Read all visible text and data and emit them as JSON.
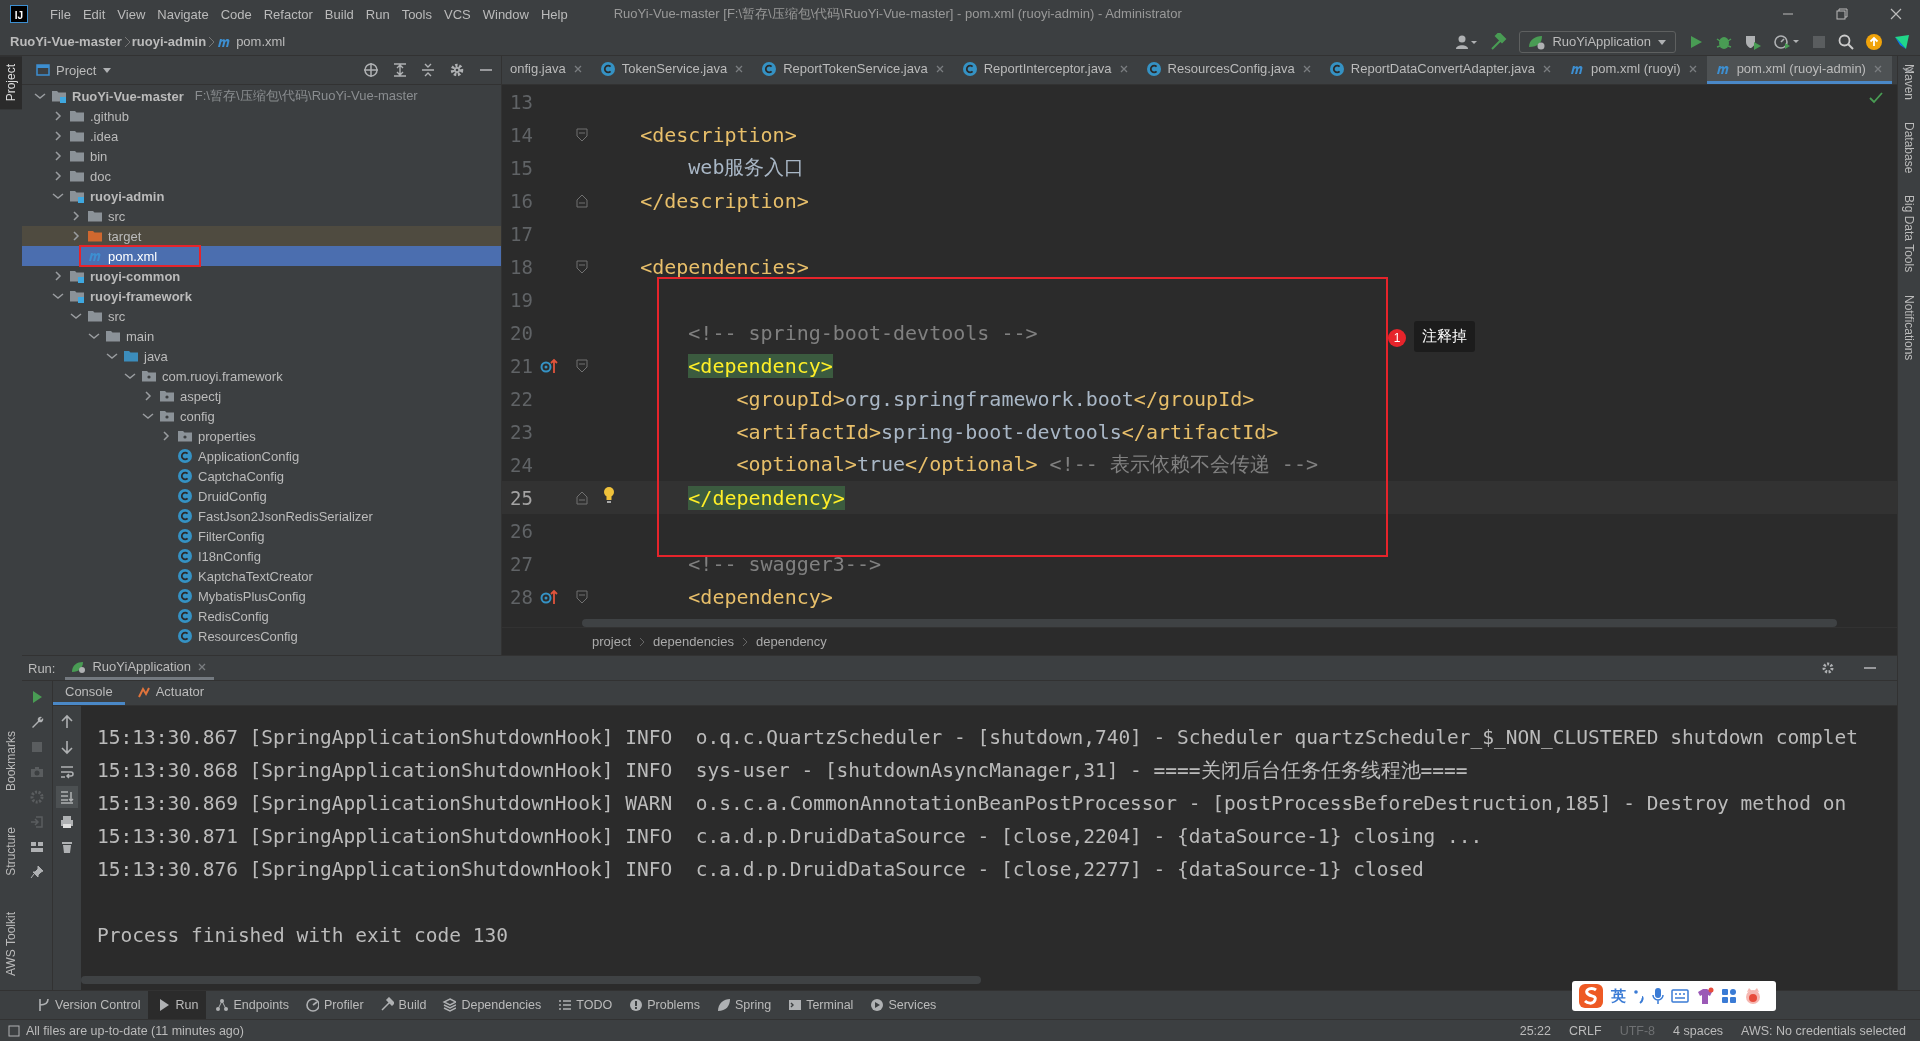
{
  "window": {
    "logo": "IJ",
    "title": "RuoYi-Vue-master [F:\\暂存\\压缩包\\代码\\RuoYi-Vue-master] - pom.xml (ruoyi-admin) - Administrator"
  },
  "menu": [
    "File",
    "Edit",
    "View",
    "Navigate",
    "Code",
    "Refactor",
    "Build",
    "Run",
    "Tools",
    "VCS",
    "Window",
    "Help"
  ],
  "nav_path": [
    {
      "label": "RuoYi-Vue-master",
      "kind": "project"
    },
    {
      "label": "ruoyi-admin",
      "kind": "module"
    },
    {
      "label": "pom.xml",
      "kind": "maven"
    }
  ],
  "run_config": "RuoYiApplication",
  "left_stripe": [
    {
      "label": "Project",
      "selected": true
    },
    {
      "label": "Bookmarks",
      "selected": false
    },
    {
      "label": "Structure",
      "selected": false
    },
    {
      "label": "AWS Toolkit",
      "selected": false
    }
  ],
  "right_stripe": [
    "Maven",
    "Database",
    "Big Data Tools",
    "Notifications"
  ],
  "project": {
    "title": "Project",
    "tree": [
      {
        "label": "RuoYi-Vue-master",
        "path": "F:\\暂存\\压缩包\\代码\\RuoYi-Vue-master",
        "kind": "module",
        "expanded": true,
        "selected": false,
        "marked": false,
        "children": [
          {
            "label": ".github",
            "kind": "folder",
            "expanded": false,
            "selected": false,
            "marked": false
          },
          {
            "label": ".idea",
            "kind": "folder",
            "expanded": false,
            "selected": false,
            "marked": false
          },
          {
            "label": "bin",
            "kind": "folder",
            "expanded": false,
            "selected": false,
            "marked": false
          },
          {
            "label": "doc",
            "kind": "folder",
            "expanded": false,
            "selected": false,
            "marked": false
          },
          {
            "label": "ruoyi-admin",
            "kind": "module",
            "expanded": true,
            "selected": false,
            "marked": false,
            "children": [
              {
                "label": "src",
                "kind": "folder",
                "expanded": false,
                "selected": false,
                "marked": false
              },
              {
                "label": "target",
                "kind": "excluded",
                "expanded": false,
                "selected": false,
                "marked": false
              },
              {
                "label": "pom.xml",
                "kind": "maven",
                "selected": true,
                "marked": true
              }
            ]
          },
          {
            "label": "ruoyi-common",
            "kind": "module",
            "expanded": false,
            "selected": false,
            "marked": false
          },
          {
            "label": "ruoyi-framework",
            "kind": "module",
            "expanded": true,
            "selected": false,
            "marked": false,
            "children": [
              {
                "label": "src",
                "kind": "folder",
                "expanded": true,
                "selected": false,
                "marked": false,
                "children": [
                  {
                    "label": "main",
                    "kind": "folder",
                    "expanded": true,
                    "selected": false,
                    "marked": false,
                    "children": [
                      {
                        "label": "java",
                        "kind": "source",
                        "expanded": true,
                        "selected": false,
                        "marked": false,
                        "children": [
                          {
                            "label": "com.ruoyi.framework",
                            "kind": "package",
                            "expanded": true,
                            "selected": false,
                            "marked": false,
                            "children": [
                              {
                                "label": "aspectj",
                                "kind": "package",
                                "expanded": false,
                                "selected": false,
                                "marked": false
                              },
                              {
                                "label": "config",
                                "kind": "package",
                                "expanded": true,
                                "selected": false,
                                "marked": false,
                                "children": [
                                  {
                                    "label": "properties",
                                    "kind": "package",
                                    "expanded": false,
                                    "selected": false,
                                    "marked": false
                                  },
                                  {
                                    "label": "ApplicationConfig",
                                    "kind": "class",
                                    "selected": false,
                                    "marked": false
                                  },
                                  {
                                    "label": "CaptchaConfig",
                                    "kind": "class",
                                    "selected": false,
                                    "marked": false
                                  },
                                  {
                                    "label": "DruidConfig",
                                    "kind": "class",
                                    "selected": false,
                                    "marked": false
                                  },
                                  {
                                    "label": "FastJson2JsonRedisSerializer",
                                    "kind": "class",
                                    "selected": false,
                                    "marked": false
                                  },
                                  {
                                    "label": "FilterConfig",
                                    "kind": "class",
                                    "selected": false,
                                    "marked": false
                                  },
                                  {
                                    "label": "I18nConfig",
                                    "kind": "class",
                                    "selected": false,
                                    "marked": false
                                  },
                                  {
                                    "label": "KaptchaTextCreator",
                                    "kind": "class",
                                    "selected": false,
                                    "marked": false
                                  },
                                  {
                                    "label": "MybatisPlusConfig",
                                    "kind": "class",
                                    "selected": false,
                                    "marked": false
                                  },
                                  {
                                    "label": "RedisConfig",
                                    "kind": "class",
                                    "selected": false,
                                    "marked": false
                                  },
                                  {
                                    "label": "ResourcesConfig",
                                    "kind": "class",
                                    "selected": false,
                                    "marked": false
                                  }
                                ]
                              }
                            ]
                          }
                        ]
                      }
                    ]
                  }
                ]
              }
            ]
          }
        ]
      }
    ]
  },
  "editor": {
    "tabs": [
      {
        "label": "onfig.java",
        "kind": "clipped",
        "selected": false
      },
      {
        "label": "TokenService.java",
        "kind": "class",
        "selected": false
      },
      {
        "label": "ReportTokenService.java",
        "kind": "class",
        "selected": false
      },
      {
        "label": "ReportInterceptor.java",
        "kind": "class",
        "selected": false
      },
      {
        "label": "ResourcesConfig.java",
        "kind": "class",
        "selected": false
      },
      {
        "label": "ReportDataConvertAdapter.java",
        "kind": "class",
        "selected": false
      },
      {
        "label": "pom.xml (ruoyi)",
        "kind": "maven",
        "selected": false
      },
      {
        "label": "pom.xml (ruoyi-admin)",
        "kind": "maven",
        "selected": true
      }
    ],
    "blocks": [
      {
        "boxed": false,
        "lines": [
          {
            "number": "13",
            "kind": "blank"
          },
          {
            "number": "14",
            "kind": "open",
            "segments": [
              {
                "kind": "tag",
                "text": "    <description>"
              }
            ]
          },
          {
            "number": "15",
            "kind": "plain",
            "segments": [
              {
                "kind": "text",
                "text": "        web服务入口"
              }
            ]
          },
          {
            "number": "16",
            "kind": "close",
            "segments": [
              {
                "kind": "tag",
                "text": "    </description>"
              }
            ]
          },
          {
            "number": "17",
            "kind": "blank"
          },
          {
            "number": "18",
            "kind": "open",
            "segments": [
              {
                "kind": "tag",
                "text": "    <dependencies>"
              }
            ]
          }
        ]
      },
      {
        "boxed": true,
        "annotation": {
          "badge": "1",
          "label": "注释掉"
        },
        "lines": [
          {
            "number": "19",
            "kind": "blank"
          },
          {
            "number": "20",
            "kind": "plain",
            "segments": [
              {
                "kind": "comment",
                "text": "        <!-- spring-boot-devtools -->"
              }
            ]
          },
          {
            "number": "21",
            "kind": "override",
            "match": true,
            "segments": [
              {
                "kind": "tag",
                "text": "        <dependency>"
              }
            ]
          },
          {
            "number": "22",
            "kind": "plain",
            "segments": [
              {
                "kind": "tag",
                "text": "            <groupId>"
              },
              {
                "kind": "text",
                "text": "org.springframework.boot"
              },
              {
                "kind": "tag",
                "text": "</groupId>"
              }
            ]
          },
          {
            "number": "23",
            "kind": "plain",
            "segments": [
              {
                "kind": "tag",
                "text": "            <artifactId>"
              },
              {
                "kind": "text",
                "text": "spring-boot-devtools"
              },
              {
                "kind": "tag",
                "text": "</artifactId>"
              }
            ]
          },
          {
            "number": "24",
            "kind": "plain",
            "segments": [
              {
                "kind": "tag",
                "text": "            <optional>"
              },
              {
                "kind": "text",
                "text": "true"
              },
              {
                "kind": "tag",
                "text": "</optional>"
              },
              {
                "kind": "comment",
                "text": " <!-- 表示依赖不会传递 -->"
              }
            ]
          },
          {
            "number": "25",
            "kind": "current",
            "match": true,
            "segments": [
              {
                "kind": "tag",
                "text": "        </dependency>"
              }
            ]
          },
          {
            "number": "26",
            "kind": "blank"
          }
        ]
      },
      {
        "boxed": false,
        "lines": [
          {
            "number": "27",
            "kind": "plain",
            "segments": [
              {
                "kind": "comment",
                "text": "        <!-- swagger3-->"
              }
            ]
          },
          {
            "number": "28",
            "kind": "override",
            "segments": [
              {
                "kind": "tag",
                "text": "        <dependency>"
              }
            ]
          }
        ]
      }
    ],
    "breadcrumb": [
      "project",
      "dependencies",
      "dependency"
    ]
  },
  "run": {
    "label": "Run:",
    "tab": "RuoYiApplication",
    "subtabs": [
      {
        "label": "Console",
        "selected": true
      },
      {
        "label": "Actuator",
        "selected": false
      }
    ],
    "output": [
      {
        "kind": "log",
        "text": "15:13:30.867 [SpringApplicationShutdownHook] INFO  o.q.c.QuartzScheduler - [shutdown,740] - Scheduler quartzScheduler_$_NON_CLUSTERED shutdown complet"
      },
      {
        "kind": "log",
        "text": "15:13:30.868 [SpringApplicationShutdownHook] INFO  sys-user - [shutdownAsyncManager,31] - ====关闭后台任务任务线程池===="
      },
      {
        "kind": "log",
        "text": "15:13:30.869 [SpringApplicationShutdownHook] WARN  o.s.c.a.CommonAnnotationBeanPostProcessor - [postProcessBeforeDestruction,185] - Destroy method on"
      },
      {
        "kind": "log",
        "text": "15:13:30.871 [SpringApplicationShutdownHook] INFO  c.a.d.p.DruidDataSource - [close,2204] - {dataSource-1} closing ..."
      },
      {
        "kind": "log",
        "text": "15:13:30.876 [SpringApplicationShutdownHook] INFO  c.a.d.p.DruidDataSource - [close,2277] - {dataSource-1} closed"
      },
      {
        "kind": "exit",
        "text": "Process finished with exit code 130"
      }
    ]
  },
  "tool_windows": [
    {
      "label": "Version Control",
      "selected": false
    },
    {
      "label": "Run",
      "selected": true
    },
    {
      "label": "Endpoints",
      "selected": false
    },
    {
      "label": "Profiler",
      "selected": false
    },
    {
      "label": "Build",
      "selected": false
    },
    {
      "label": "Dependencies",
      "selected": false
    },
    {
      "label": "TODO",
      "selected": false
    },
    {
      "label": "Problems",
      "selected": false
    },
    {
      "label": "Spring",
      "selected": false
    },
    {
      "label": "Terminal",
      "selected": false
    },
    {
      "label": "Services",
      "selected": false
    }
  ],
  "status": {
    "message": "All files are up-to-date (11 minutes ago)",
    "items": [
      {
        "text": "25:22",
        "disabled": false
      },
      {
        "text": "CRLF",
        "disabled": false
      },
      {
        "text": "UTF-8",
        "disabled": true
      },
      {
        "text": "4 spaces",
        "disabled": false
      },
      {
        "text": "AWS: No credentials selected",
        "disabled": false
      }
    ]
  },
  "ime": {
    "label": "英"
  }
}
